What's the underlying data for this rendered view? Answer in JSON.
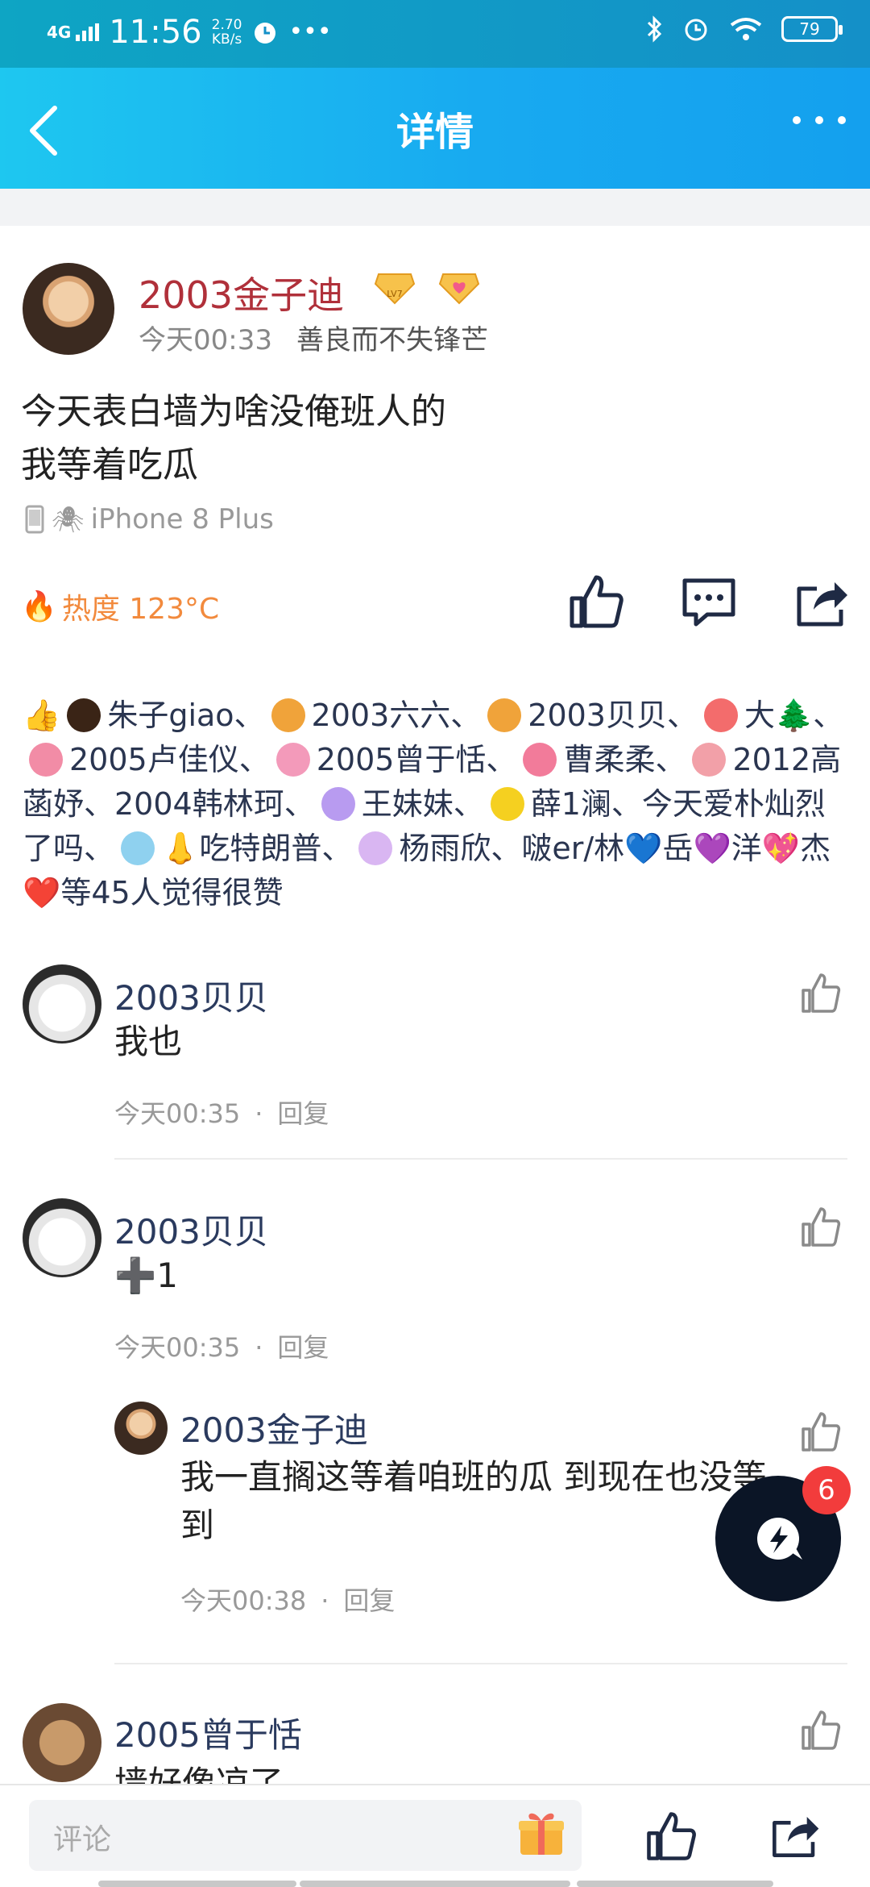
{
  "status_bar": {
    "network": "4G",
    "time": "11:56",
    "speed_value": "2.70",
    "speed_unit": "KB/s",
    "battery": "79"
  },
  "nav": {
    "title": "详情"
  },
  "post": {
    "author": "2003金子迪",
    "level_badge": "LV7",
    "time": "今天00:33",
    "signature": "善良而不失锋芒",
    "text": "今天表白墙为啥没俺班人的\n我等着吃瓜",
    "device": "iPhone 8 Plus",
    "heat": "热度 123°C"
  },
  "likes_text": {
    "part1": "朱子giao、",
    "part2": "2003六六、",
    "part3": "2003贝贝、",
    "part4": "大🌲、",
    "part5": "2005卢佳仪、",
    "part6": "2005曾于恬、",
    "part7": "曹柔柔、",
    "part8": "2012高菡妤、2004韩林珂、",
    "part9": "王妹妹、",
    "part10": "薛1澜、今天爱朴灿烈了吗、",
    "part11": "👃吃特朗普、",
    "part12": "杨雨欣、啵er/林💙岳💜洋💖杰❤️等45人觉得很赞"
  },
  "comments": [
    {
      "name": "2003贝贝",
      "text": "我也",
      "time": "今天00:35",
      "reply_label": "回复"
    },
    {
      "name": "2003贝贝",
      "text": "➕1",
      "time": "今天00:35",
      "reply_label": "回复"
    },
    {
      "name": "2005曾于恬",
      "text": "墙好像凉了"
    }
  ],
  "reply": {
    "name": "2003金子迪",
    "text": " 我一直搁这等着咱班的瓜 到现在也没等到",
    "time": "今天00:38",
    "reply_label": "回复"
  },
  "fab": {
    "badge": "6"
  },
  "bottom_bar": {
    "placeholder": "评论"
  },
  "colors": {
    "nav_gradient_start": "#1ec7f0",
    "nav_gradient_end": "#14a0ee",
    "author_red": "#b0303a",
    "name_blue": "#2a3a5e",
    "heat_orange": "#f28a3d",
    "badge_red": "#f23c3c"
  }
}
